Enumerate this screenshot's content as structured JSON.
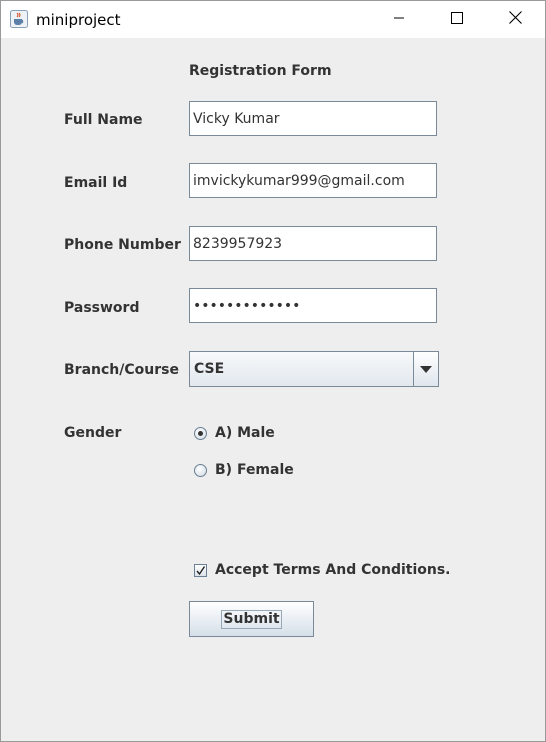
{
  "window": {
    "title": "miniproject",
    "app_icon": "java-cup-icon",
    "controls": [
      "minimize-icon",
      "maximize-icon",
      "close-icon"
    ]
  },
  "form": {
    "title": "Registration Form",
    "full_name": {
      "label": "Full Name",
      "value": "Vicky Kumar"
    },
    "email": {
      "label": "Email Id",
      "value": "imvickykumar999@gmail.com"
    },
    "phone": {
      "label": "Phone Number",
      "value": "8239957923"
    },
    "password": {
      "label": "Password",
      "value": "•••••••••••••"
    },
    "branch": {
      "label": "Branch/Course",
      "selected": "CSE"
    },
    "gender": {
      "label": "Gender",
      "options": [
        {
          "label": "A) Male",
          "selected": true
        },
        {
          "label": "B) Female",
          "selected": false
        }
      ]
    },
    "terms": {
      "label": "Accept Terms And Conditions.",
      "checked": true
    },
    "submit_label": "Submit"
  },
  "colors": {
    "window_bg": "#eeeeee",
    "titlebar_bg": "#ffffff",
    "text": "#333333",
    "field_border": "#7a8a99"
  }
}
